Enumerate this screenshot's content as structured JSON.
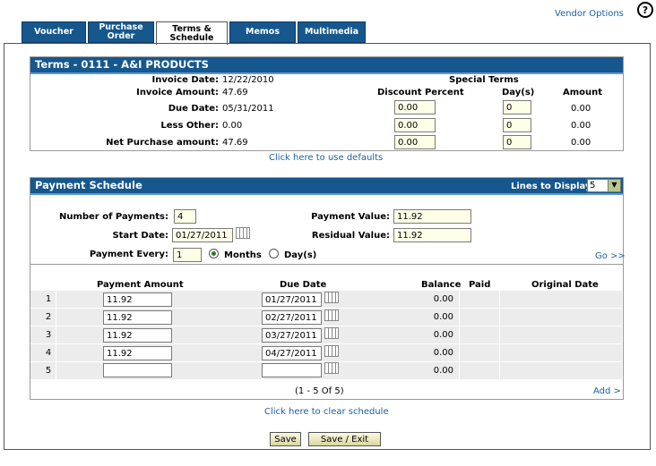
{
  "header": {
    "vendor_options": "Vendor Options",
    "help": "?"
  },
  "tabs": [
    {
      "label": "Voucher"
    },
    {
      "label_line1": "Purchase",
      "label_line2": "Order"
    },
    {
      "label_line1": "Terms &",
      "label_line2": "Schedule"
    },
    {
      "label": "Memos"
    },
    {
      "label": "Multimedia"
    }
  ],
  "terms": {
    "title": "Terms -  0111 - A&I PRODUCTS",
    "invoice_date_label": "Invoice Date:",
    "invoice_date": "12/22/2010",
    "invoice_amount_label": "Invoice Amount:",
    "invoice_amount": "47.69",
    "due_date_label": "Due Date:",
    "due_date": "05/31/2011",
    "less_other_label": "Less Other:",
    "less_other": "0.00",
    "net_purchase_label": "Net Purchase amount:",
    "net_purchase": "47.69",
    "special_terms": "Special Terms",
    "col_discount": "Discount Percent",
    "col_days": "Day(s)",
    "col_amount": "Amount",
    "rows": [
      {
        "discount": "0.00",
        "days": "0",
        "amount": "0.00"
      },
      {
        "discount": "0.00",
        "days": "0",
        "amount": "0.00"
      },
      {
        "discount": "0.00",
        "days": "0",
        "amount": "0.00"
      }
    ],
    "defaults_link": "Click here to use defaults"
  },
  "schedule": {
    "title": "Payment Schedule",
    "lines_label": "Lines to Display:",
    "lines_value": "5",
    "num_payments_label": "Number of Payments:",
    "num_payments": "4",
    "start_date_label": "Start Date:",
    "start_date": "01/27/2011",
    "payment_every_label": "Payment Every:",
    "payment_every": "1",
    "months_label": "Months",
    "days_label": "Day(s)",
    "payment_value_label": "Payment Value:",
    "payment_value": "11.92",
    "residual_value_label": "Residual Value:",
    "residual_value": "11.92",
    "go_link": "Go >>",
    "col_num": "",
    "col_amount": "Payment Amount",
    "col_due": "Due Date",
    "col_balance": "Balance",
    "col_paid": "Paid",
    "col_original": "Original Date",
    "rows": [
      {
        "num": "1",
        "amount": "11.92",
        "due": "01/27/2011",
        "balance": "0.00"
      },
      {
        "num": "2",
        "amount": "11.92",
        "due": "02/27/2011",
        "balance": "0.00"
      },
      {
        "num": "3",
        "amount": "11.92",
        "due": "03/27/2011",
        "balance": "0.00"
      },
      {
        "num": "4",
        "amount": "11.92",
        "due": "04/27/2011",
        "balance": "0.00"
      },
      {
        "num": "5",
        "amount": "",
        "due": "",
        "balance": "0.00"
      }
    ],
    "pager": "(1 - 5 Of 5)",
    "add_link": "Add >",
    "clear_link": "Click here to clear schedule"
  },
  "buttons": {
    "save": "Save",
    "save_exit": "Save / Exit"
  }
}
